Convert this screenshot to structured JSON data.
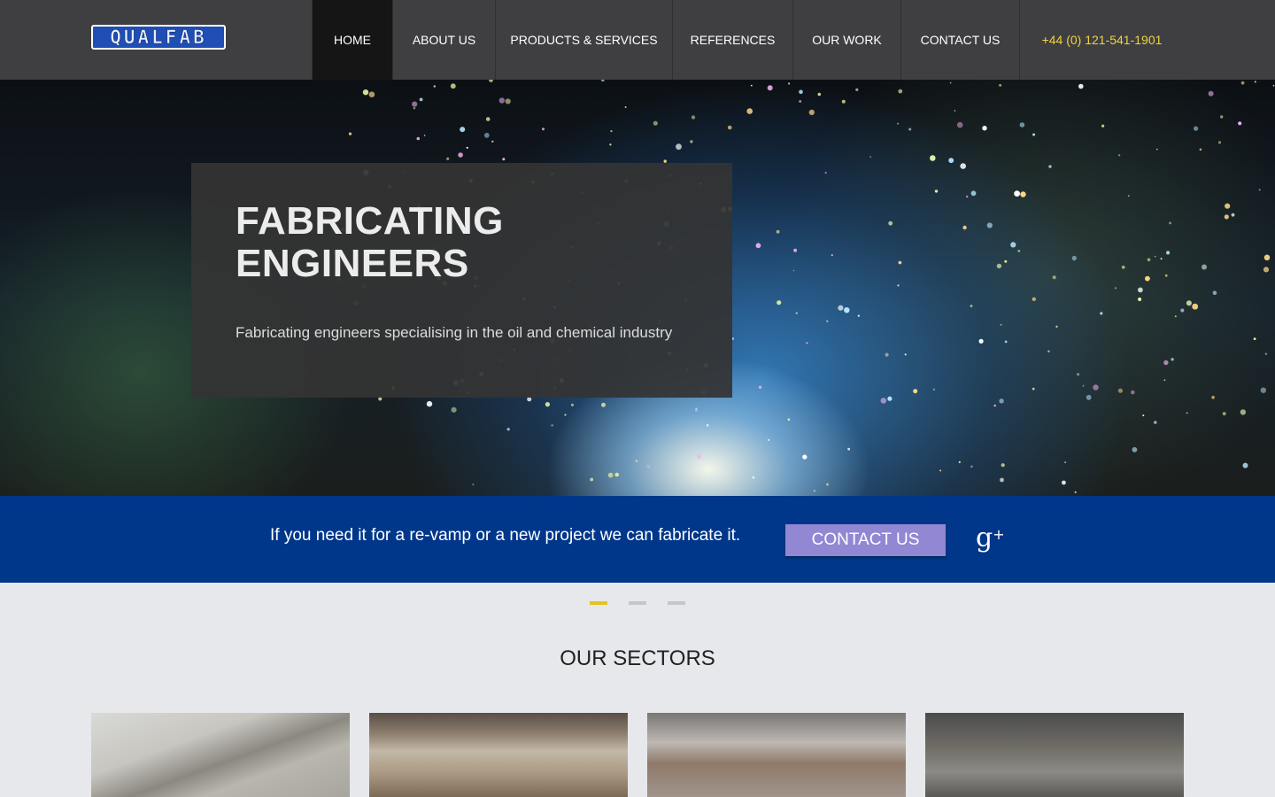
{
  "header": {
    "logo_text": "QUALFAB",
    "nav": [
      {
        "label": "HOME",
        "active": true
      },
      {
        "label": "ABOUT US"
      },
      {
        "label": "PRODUCTS & SERVICES"
      },
      {
        "label": "REFERENCES"
      },
      {
        "label": "OUR WORK"
      },
      {
        "label": "CONTACT US"
      }
    ],
    "phone": "+44 (0) 121-541-1901"
  },
  "hero": {
    "title_line1": "FABRICATING",
    "title_line2": "ENGINEERS",
    "subtitle": "Fabricating engineers specialising in the oil and chemical industry"
  },
  "cta": {
    "text": "If you need it for a re-vamp or a new project we can fabricate it.",
    "button_label": "CONTACT US",
    "social_icon": "google-plus-icon",
    "social_glyph": "g",
    "social_plus": "+"
  },
  "slider": {
    "slide_count": 3,
    "active_index": 0
  },
  "sectors": {
    "title": "OUR SECTORS",
    "cards": [
      {
        "icon": "sector-photo"
      },
      {
        "icon": "sector-photo"
      },
      {
        "icon": "sector-photo"
      },
      {
        "icon": "sector-photo"
      }
    ]
  },
  "colors": {
    "header_bg": "#3f3f41",
    "active_nav_bg": "#151515",
    "phone": "#f0d340",
    "band_bg": "#01378a",
    "cta_button": "#9187d3",
    "dot_active": "#e6c21f",
    "dot_inactive": "#c4c6c9",
    "page_bg": "#e6e8eb"
  }
}
